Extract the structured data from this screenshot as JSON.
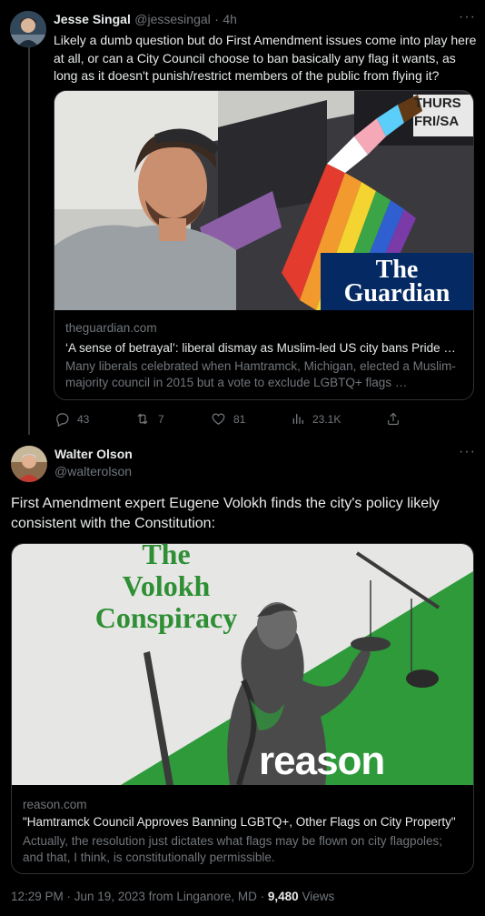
{
  "reply_tweet": {
    "author_name": "Jesse Singal",
    "author_handle": "@jessesingal",
    "separator": "·",
    "time": "4h",
    "text": "Likely a dumb question but do First Amendment issues come into play here at all, or can a City Council choose to ban basically any flag it wants, as long as it doesn't punish/restrict members of the public from flying it?",
    "card": {
      "sign_line1": "THURS",
      "sign_line2": "FRI/SA",
      "logo_line1": "The",
      "logo_line2": "Guardian",
      "domain": "theguardian.com",
      "title": "‘A sense of betrayal’: liberal dismay as Muslim-led US city bans Pride …",
      "description": "Many liberals celebrated when Hamtramck, Michigan, elected a Muslim-majority council in 2015 but a vote to exclude LGBTQ+ flags …"
    },
    "actions": {
      "replies": "43",
      "reposts": "7",
      "likes": "81",
      "views": "23.1K"
    }
  },
  "main_tweet": {
    "author_name": "Walter Olson",
    "author_handle": "@walterolson",
    "text": "First Amendment expert Eugene Volokh finds the city's policy likely consistent with the Constitution:",
    "card": {
      "logo_line1": "The",
      "logo_line2": "Volokh",
      "logo_line3": "Conspiracy",
      "brand": "reason",
      "domain": "reason.com",
      "title": "\"Hamtramck Council Approves Banning LGBTQ+, Other Flags on City Property\"",
      "description": "Actually, the resolution just dictates what flags may be flown on city flagpoles; and that, I think, is constitutionally permissible."
    },
    "footer": {
      "timestamp": "12:29 PM · Jun 19, 2023 from Linganore, MD · ",
      "views_count": "9,480",
      "views_label": " Views"
    }
  },
  "more_icon": "···",
  "colors": {
    "background": "#000000",
    "text": "#e7e9ea",
    "muted": "#71767b",
    "border": "#2f3336",
    "guardian_blue": "#052962",
    "volokh_green": "#2e9a3a"
  }
}
